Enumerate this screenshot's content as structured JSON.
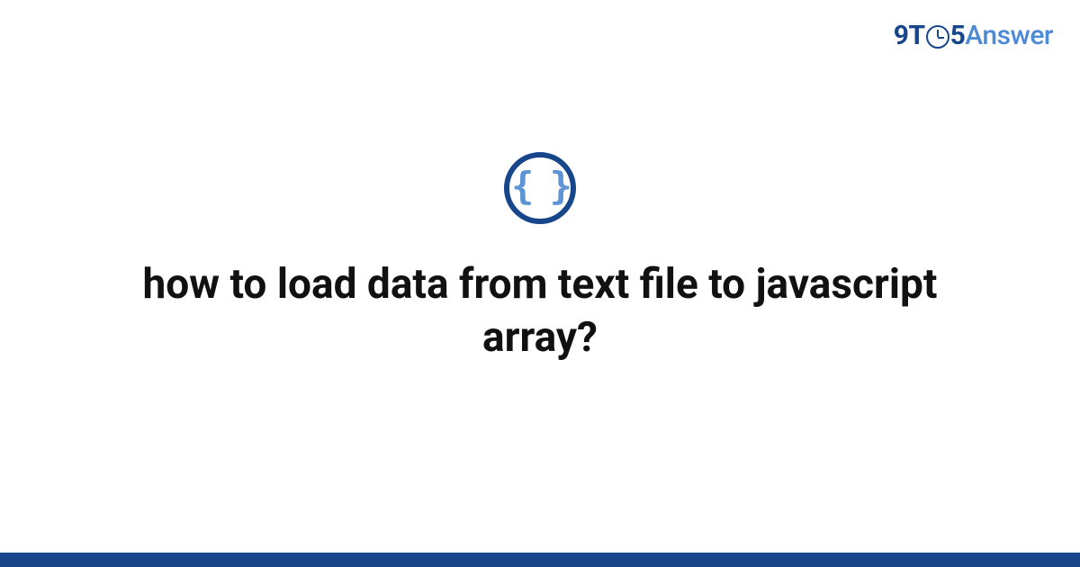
{
  "logo": {
    "part1": "9T",
    "part2": "5",
    "part3": "Answer"
  },
  "icon": {
    "braces": "{ }"
  },
  "title": "how to load data from text file to javascript array?",
  "colors": {
    "primary": "#17468b",
    "accent": "#4d8bd6",
    "text": "#111111"
  }
}
